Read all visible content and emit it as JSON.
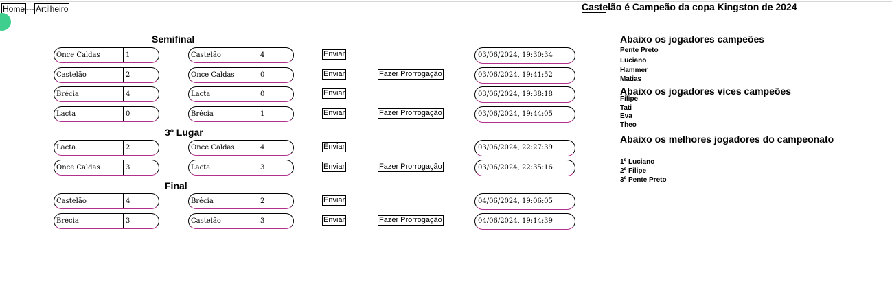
{
  "nav": {
    "home": "Home",
    "separator": "---",
    "artilheiro": "Artilheiro"
  },
  "champion_banner": "Castelão é Campeão da copa Kingston de 2024",
  "sections": {
    "semifinal": "Semifinal",
    "third_place": "3º Lugar",
    "final": "Final"
  },
  "buttons": {
    "send": "Enviar",
    "extra_time": "Fazer Prorrogação"
  },
  "matches": [
    {
      "team1": "Once Caldas",
      "score1": "1",
      "team2": "Castelão",
      "score2": "4",
      "datetime": "03/06/2024, 19:30:34"
    },
    {
      "team1": "Castelão",
      "score1": "2",
      "team2": "Once Caldas",
      "score2": "0",
      "datetime": "03/06/2024, 19:41:52"
    },
    {
      "team1": "Brécia",
      "score1": "4",
      "team2": "Lacta",
      "score2": "0",
      "datetime": "03/06/2024, 19:38:18"
    },
    {
      "team1": "Lacta",
      "score1": "0",
      "team2": "Brécia",
      "score2": "1",
      "datetime": "03/06/2024, 19:44:05"
    },
    {
      "team1": "Lacta",
      "score1": "2",
      "team2": "Once Caldas",
      "score2": "4",
      "datetime": "03/06/2024, 22:27:39"
    },
    {
      "team1": "Once Caldas",
      "score1": "3",
      "team2": "Lacta",
      "score2": "3",
      "datetime": "03/06/2024, 22:35:16"
    },
    {
      "team1": "Castelão",
      "score1": "4",
      "team2": "Brécia",
      "score2": "2",
      "datetime": "04/06/2024, 19:06:05"
    },
    {
      "team1": "Brécia",
      "score1": "3",
      "team2": "Castelão",
      "score2": "3",
      "datetime": "04/06/2024, 19:14:39"
    }
  ],
  "right_panel": {
    "champions_title": "Abaixo os jogadores campeões",
    "champions": [
      "Pente Preto",
      "Luciano",
      "Hammer",
      "Matias"
    ],
    "vices_title": "Abaixo os jogadores vices campeões",
    "vices": [
      "Filipe",
      "Tati",
      "Eva",
      "Theo"
    ],
    "best_title": "Abaixo os melhores jogadores do campeonato",
    "best": [
      "1º Luciano",
      "2º Filipe",
      "3º Pente Preto"
    ]
  },
  "colors": {
    "accent_border": "#b0308a",
    "fab": "#3ecf8e"
  }
}
